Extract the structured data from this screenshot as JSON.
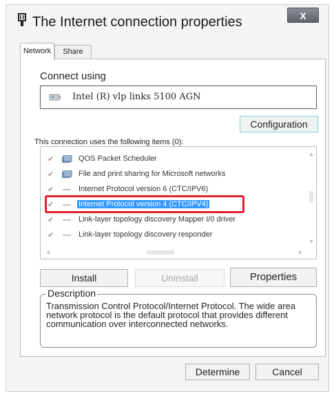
{
  "window": {
    "title": "The Internet connection properties",
    "close_label": "X"
  },
  "tabs": [
    {
      "label": "Network",
      "active": true
    },
    {
      "label": "Share",
      "active": false
    }
  ],
  "connect_using": {
    "label": "Connect using",
    "adapter_name": "Intel (R) vlp links 5100 AGN",
    "configuration_button": "Configuration"
  },
  "items_section": {
    "label": "This connection uses the following items (0):",
    "items": [
      {
        "label": "QOS Packet Scheduler",
        "checked": true,
        "icon": "scheduler-icon",
        "selected": false
      },
      {
        "label": "File and print sharing for Microsoft networks",
        "checked": true,
        "icon": "sharing-icon",
        "selected": false
      },
      {
        "label": "Internet Protocol version 6 (CTC/IPV6)",
        "checked": true,
        "icon": "protocol-icon",
        "selected": false
      },
      {
        "label": "Internet Protocol version 4 (CTC/IPV4)",
        "checked": true,
        "icon": "protocol-icon",
        "selected": true
      },
      {
        "label": "Link-layer topology discovery Mapper I/0 driver",
        "checked": true,
        "icon": "protocol-icon",
        "selected": false
      },
      {
        "label": "Link-layer topology discovery responder",
        "checked": true,
        "icon": "protocol-icon",
        "selected": false
      }
    ]
  },
  "actions": {
    "install": "Install",
    "uninstall": "Uninstall",
    "properties": "Properties"
  },
  "description": {
    "legend": "Description",
    "text": "Transmission Control Protocol/Internet Protocol. The wide area network protocol is the default protocol that provides different communication over interconnected networks."
  },
  "footer": {
    "ok": "Determine",
    "cancel": "Cancel"
  },
  "colors": {
    "selection": "#3399ff",
    "highlight_border": "#e0202a"
  }
}
